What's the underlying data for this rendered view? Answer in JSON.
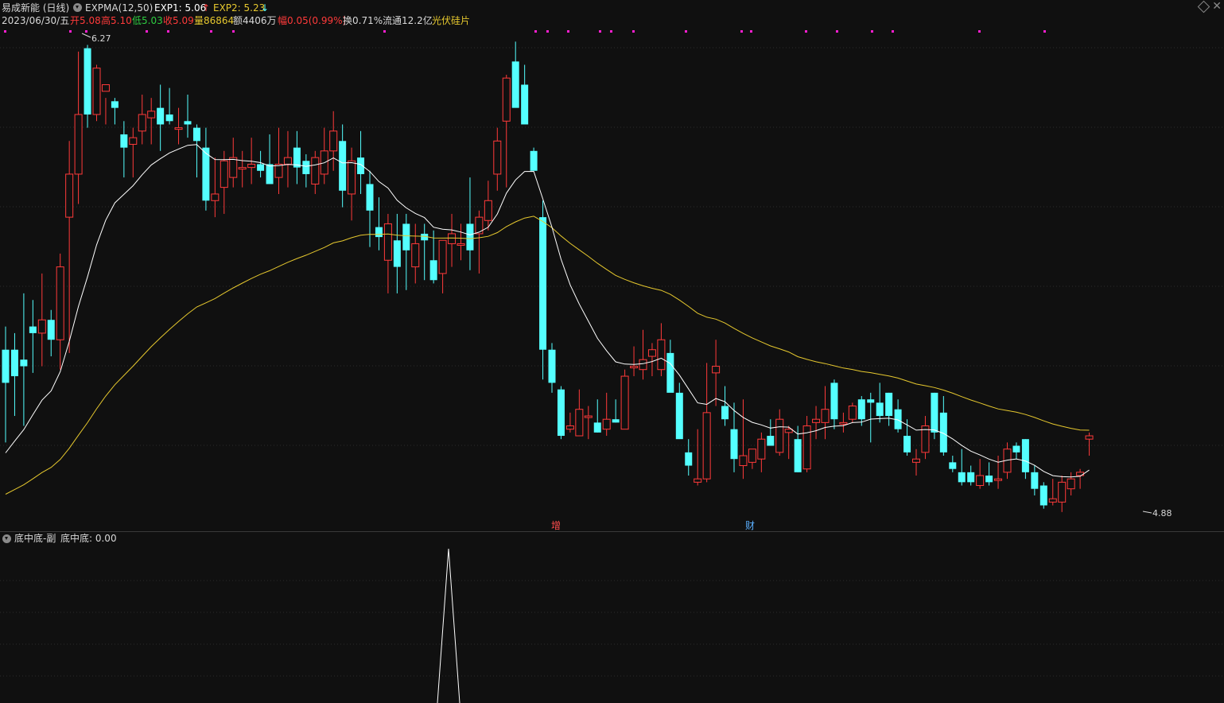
{
  "header": {
    "stock_name": "易成新能 (日线)",
    "indicator": "EXPMA(12,50)",
    "exp1_label": "EXP1: 5.06",
    "exp1_arrow": "↑",
    "exp2_label": "EXP2: 5.23",
    "exp2_arrow": "↓"
  },
  "quote": {
    "date": "2023/06/30/五",
    "open": "开5.08",
    "high": "高5.10",
    "low": "低5.03",
    "close": "收5.09",
    "volume": "量86864",
    "amount": "额4406万",
    "change": "幅0.05(0.99%)",
    "turnover": "换0.71%",
    "float_cap": "流通12.2亿",
    "sector": "光伏硅片"
  },
  "annotations": {
    "high_label": "6.27",
    "low_label": "4.88",
    "event_zeng": "增",
    "event_cai": "财"
  },
  "sub_panel": {
    "title": "底中底-副",
    "value_label": "底中底: 0.00"
  },
  "colors": {
    "background": "#101010",
    "up": "#ff3a3a",
    "down": "#54ffff",
    "exp1": "#ffffff",
    "exp2": "#e6c82e",
    "magenta_marker": "#ff1fd1",
    "grid": "#2b2b2b"
  },
  "chart_data": {
    "type": "candlestick",
    "price_range": [
      4.8,
      6.35
    ],
    "dates_end": "2023/06/30",
    "candles": [
      [
        5.35,
        5.42,
        5.07,
        5.25
      ],
      [
        5.35,
        5.4,
        5.15,
        5.27
      ],
      [
        5.32,
        5.52,
        5.12,
        5.3
      ],
      [
        5.42,
        5.5,
        5.28,
        5.4
      ],
      [
        5.4,
        5.58,
        5.3,
        5.44
      ],
      [
        5.44,
        5.47,
        5.33,
        5.38
      ],
      [
        5.38,
        5.64,
        5.29,
        5.6
      ],
      [
        5.75,
        5.98,
        5.34,
        5.88
      ],
      [
        5.88,
        6.25,
        5.79,
        6.06
      ],
      [
        6.26,
        6.27,
        6.02,
        6.06
      ],
      [
        6.06,
        6.21,
        6.04,
        6.2
      ],
      [
        6.13,
        6.11,
        6.03,
        6.15
      ],
      [
        6.1,
        6.11,
        6.03,
        6.08
      ],
      [
        6.0,
        6.04,
        5.87,
        5.96
      ],
      [
        5.97,
        6.02,
        5.87,
        5.99
      ],
      [
        6.01,
        6.12,
        5.97,
        6.06
      ],
      [
        6.05,
        6.11,
        5.97,
        6.07
      ],
      [
        6.08,
        6.15,
        5.95,
        6.03
      ],
      [
        6.06,
        6.14,
        6.03,
        6.04
      ],
      [
        6.02,
        6.08,
        5.97,
        6.02
      ],
      [
        6.04,
        6.12,
        5.99,
        6.03
      ],
      [
        6.02,
        6.03,
        5.87,
        5.98
      ],
      [
        5.96,
        6.02,
        5.77,
        5.8
      ],
      [
        5.8,
        5.93,
        5.75,
        5.82
      ],
      [
        5.84,
        5.95,
        5.76,
        5.92
      ],
      [
        5.87,
        5.99,
        5.84,
        5.93
      ],
      [
        5.9,
        5.95,
        5.84,
        5.9
      ],
      [
        5.9,
        5.99,
        5.85,
        5.91
      ],
      [
        5.91,
        5.95,
        5.87,
        5.89
      ],
      [
        5.91,
        6.0,
        5.86,
        5.85
      ],
      [
        5.87,
        6.02,
        5.82,
        5.91
      ],
      [
        5.91,
        6.01,
        5.84,
        5.93
      ],
      [
        5.96,
        6.01,
        5.85,
        5.9
      ],
      [
        5.92,
        5.94,
        5.84,
        5.88
      ],
      [
        5.85,
        5.95,
        5.82,
        5.93
      ],
      [
        5.88,
        6.02,
        5.85,
        5.95
      ],
      [
        5.95,
        6.07,
        5.89,
        6.01
      ],
      [
        5.98,
        6.03,
        5.78,
        5.83
      ],
      [
        5.82,
        5.96,
        5.74,
        5.92
      ],
      [
        5.93,
        6.01,
        5.82,
        5.88
      ],
      [
        5.85,
        5.89,
        5.66,
        5.77
      ],
      [
        5.72,
        5.81,
        5.65,
        5.69
      ],
      [
        5.62,
        5.76,
        5.52,
        5.73
      ],
      [
        5.68,
        5.76,
        5.52,
        5.6
      ],
      [
        5.73,
        5.76,
        5.53,
        5.65
      ],
      [
        5.6,
        5.73,
        5.55,
        5.67
      ],
      [
        5.7,
        5.73,
        5.56,
        5.68
      ],
      [
        5.62,
        5.71,
        5.55,
        5.56
      ],
      [
        5.58,
        5.68,
        5.52,
        5.68
      ],
      [
        5.67,
        5.76,
        5.6,
        5.7
      ],
      [
        5.67,
        5.73,
        5.62,
        5.67
      ],
      [
        5.73,
        5.87,
        5.59,
        5.65
      ],
      [
        5.7,
        5.77,
        5.58,
        5.75
      ],
      [
        5.74,
        5.86,
        5.71,
        5.8
      ],
      [
        5.88,
        6.02,
        5.83,
        5.98
      ],
      [
        6.04,
        6.18,
        5.84,
        6.17
      ],
      [
        6.22,
        6.28,
        6.12,
        6.08
      ],
      [
        6.15,
        6.21,
        6.04,
        6.03
      ],
      [
        5.95,
        5.96,
        5.9,
        5.89
      ],
      [
        5.75,
        5.8,
        5.26,
        5.35
      ],
      [
        5.35,
        5.37,
        5.22,
        5.25
      ],
      [
        5.23,
        5.24,
        5.08,
        5.09
      ],
      [
        5.11,
        5.16,
        5.1,
        5.12
      ],
      [
        5.09,
        5.23,
        5.09,
        5.17
      ],
      [
        5.15,
        5.18,
        5.08,
        5.15
      ],
      [
        5.13,
        5.2,
        5.1,
        5.1
      ],
      [
        5.11,
        5.22,
        5.09,
        5.14
      ],
      [
        5.14,
        5.2,
        5.13,
        5.13
      ],
      [
        5.11,
        5.29,
        5.13,
        5.27
      ],
      [
        5.3,
        5.36,
        5.27,
        5.3
      ],
      [
        5.29,
        5.41,
        5.26,
        5.32
      ],
      [
        5.33,
        5.37,
        5.27,
        5.35
      ],
      [
        5.29,
        5.43,
        5.27,
        5.38
      ],
      [
        5.34,
        5.38,
        5.24,
        5.22
      ],
      [
        5.22,
        5.25,
        5.09,
        5.08
      ],
      [
        5.04,
        5.08,
        4.97,
        5.0
      ],
      [
        4.95,
        5.11,
        4.94,
        4.96
      ],
      [
        4.96,
        5.31,
        4.95,
        5.16
      ],
      [
        5.28,
        5.38,
        5.18,
        5.3
      ],
      [
        5.18,
        5.24,
        5.12,
        5.14
      ],
      [
        5.11,
        5.19,
        4.98,
        5.02
      ],
      [
        5.0,
        5.2,
        4.96,
        5.03
      ],
      [
        5.01,
        5.05,
        4.99,
        5.05
      ],
      [
        5.02,
        5.1,
        4.98,
        5.08
      ],
      [
        5.09,
        5.14,
        5.06,
        5.06
      ],
      [
        5.04,
        5.17,
        5.03,
        5.14
      ],
      [
        5.1,
        5.12,
        5.02,
        5.11
      ],
      [
        5.08,
        5.12,
        4.98,
        4.98
      ],
      [
        4.99,
        5.15,
        4.98,
        5.12
      ],
      [
        5.13,
        5.18,
        5.08,
        5.14
      ],
      [
        5.13,
        5.24,
        5.08,
        5.17
      ],
      [
        5.25,
        5.26,
        5.11,
        5.14
      ],
      [
        5.13,
        5.16,
        5.1,
        5.13
      ],
      [
        5.14,
        5.19,
        5.13,
        5.18
      ],
      [
        5.2,
        5.21,
        5.12,
        5.14
      ],
      [
        5.2,
        5.22,
        5.07,
        5.19
      ],
      [
        5.19,
        5.25,
        5.13,
        5.15
      ],
      [
        5.22,
        5.22,
        5.12,
        5.15
      ],
      [
        5.17,
        5.2,
        5.1,
        5.11
      ],
      [
        5.09,
        5.14,
        5.03,
        5.04
      ],
      [
        5.01,
        5.05,
        4.97,
        5.02
      ],
      [
        5.04,
        5.15,
        5.02,
        5.12
      ],
      [
        5.22,
        5.22,
        5.08,
        5.1
      ],
      [
        5.16,
        5.21,
        5.03,
        5.04
      ],
      [
        5.01,
        5.03,
        4.98,
        4.99
      ],
      [
        4.98,
        5.05,
        4.94,
        4.95
      ],
      [
        4.98,
        5.0,
        4.94,
        4.95
      ],
      [
        4.94,
        5.02,
        4.93,
        4.97
      ],
      [
        4.97,
        5.01,
        4.94,
        4.95
      ],
      [
        4.96,
        5.03,
        4.93,
        4.96
      ],
      [
        4.98,
        5.07,
        4.96,
        5.05
      ],
      [
        5.06,
        5.07,
        5.02,
        5.04
      ],
      [
        5.08,
        5.08,
        4.96,
        4.98
      ],
      [
        4.98,
        5.0,
        4.91,
        4.93
      ],
      [
        4.94,
        4.95,
        4.87,
        4.88
      ],
      [
        4.89,
        4.96,
        4.88,
        4.9
      ],
      [
        4.89,
        4.97,
        4.86,
        4.95
      ],
      [
        4.93,
        4.98,
        4.91,
        4.96
      ],
      [
        4.97,
        4.99,
        4.93,
        4.98
      ],
      [
        5.08,
        5.1,
        5.03,
        5.09
      ]
    ],
    "sub_series": {
      "name": "底中底",
      "peak_index": 56,
      "values_note": "0 except spike"
    }
  }
}
